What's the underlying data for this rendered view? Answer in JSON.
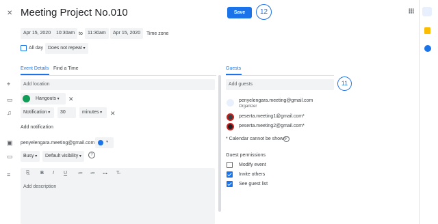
{
  "header": {
    "close_glyph": "✕",
    "title": "Meeting Project No.010",
    "save_label": "Save",
    "annotation_save": "12",
    "apps_glyph": "⋮⋮⋮"
  },
  "datetime": {
    "start_date": "Apr 15, 2020",
    "start_time": "10:30am",
    "to_label": "to",
    "end_time": "11:30am",
    "end_date": "Apr 15, 2020",
    "timezone_label": "Time zone",
    "allday_label": "All day",
    "repeat_label": "Does not repeat"
  },
  "tabs": {
    "event_details": "Event Details",
    "find_time": "Find a Time"
  },
  "details": {
    "location_placeholder": "Add location",
    "conference_label": "Hangouts",
    "notification_type": "Notification",
    "notification_value": "30",
    "notification_unit": "minutes",
    "add_notification": "Add notification",
    "calendar_owner": "penyelengara.meeting@gmail.com",
    "busy_label": "Busy",
    "visibility_label": "Default visibility",
    "description_placeholder": "Add description"
  },
  "guests": {
    "heading": "Guests",
    "input_placeholder": "Add guests",
    "annotation_guests": "11",
    "list": [
      {
        "email": "penyelengara.meeting@gmail.com",
        "role": "Organizer"
      },
      {
        "email": "peserta.meeting1@gmail.com*",
        "role": ""
      },
      {
        "email": "peserta.meeting2@gmail.com*",
        "role": ""
      }
    ],
    "calendar_note": "* Calendar cannot be shown",
    "permissions_heading": "Guest permissions",
    "permissions": [
      {
        "label": "Modify event",
        "checked": false
      },
      {
        "label": "Invite others",
        "checked": true
      },
      {
        "label": "See guest list",
        "checked": true
      }
    ]
  },
  "colors": {
    "accent": "#1a73e8",
    "field_bg": "#f1f3f4",
    "annotation": "#1a73e8"
  }
}
